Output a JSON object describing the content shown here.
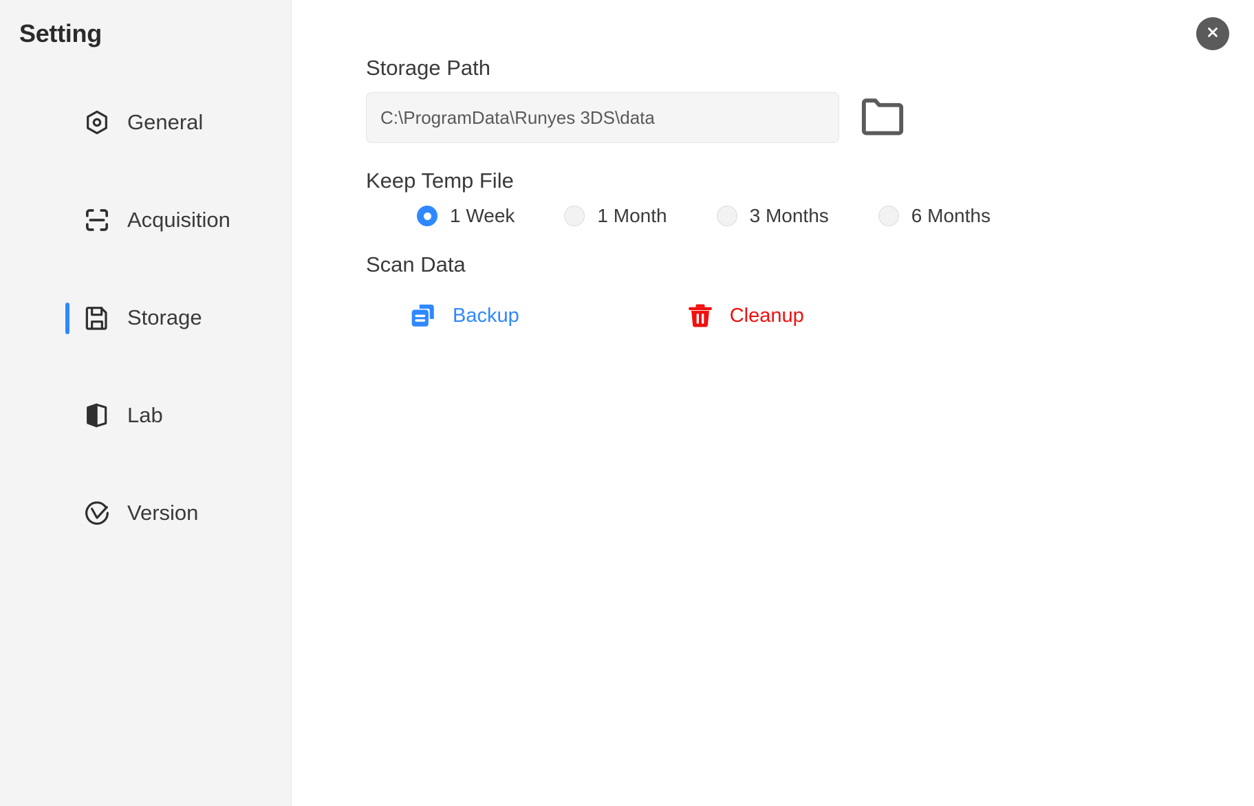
{
  "window": {
    "title": "Setting",
    "close_icon": "close-icon"
  },
  "sidebar": {
    "title": "Setting",
    "items": [
      {
        "label": "General",
        "icon": "hexagon-gear-icon",
        "active": false
      },
      {
        "label": "Acquisition",
        "icon": "scan-frame-icon",
        "active": false
      },
      {
        "label": "Storage",
        "icon": "floppy-disk-icon",
        "active": true
      },
      {
        "label": "Lab",
        "icon": "cube-box-icon",
        "active": false
      },
      {
        "label": "Version",
        "icon": "circle-v-check-icon",
        "active": false
      }
    ]
  },
  "main": {
    "storage_path": {
      "label": "Storage Path",
      "value": "C:\\ProgramData\\Runyes 3DS\\data",
      "placeholder": "C:\\ProgramData\\Runyes 3DS\\data",
      "browse_icon": "folder-icon"
    },
    "keep_temp_file": {
      "label": "Keep Temp File",
      "selected": "1 Week",
      "options": [
        {
          "label": "1 Week",
          "selected": true
        },
        {
          "label": "1 Month",
          "selected": false
        },
        {
          "label": "3 Months",
          "selected": false
        },
        {
          "label": "6 Months",
          "selected": false
        }
      ]
    },
    "scan_data": {
      "label": "Scan Data",
      "actions": [
        {
          "label": "Backup",
          "icon": "copy-duplicate-icon",
          "color": "#2f88ff"
        },
        {
          "label": "Cleanup",
          "icon": "trash-icon",
          "color": "#f01010"
        }
      ]
    }
  },
  "colors": {
    "accent": "#2f88ff",
    "danger": "#f01010",
    "sidebar_bg": "#f4f4f5",
    "text": "#3a3a3a",
    "close_bg": "#5b5b5b"
  }
}
